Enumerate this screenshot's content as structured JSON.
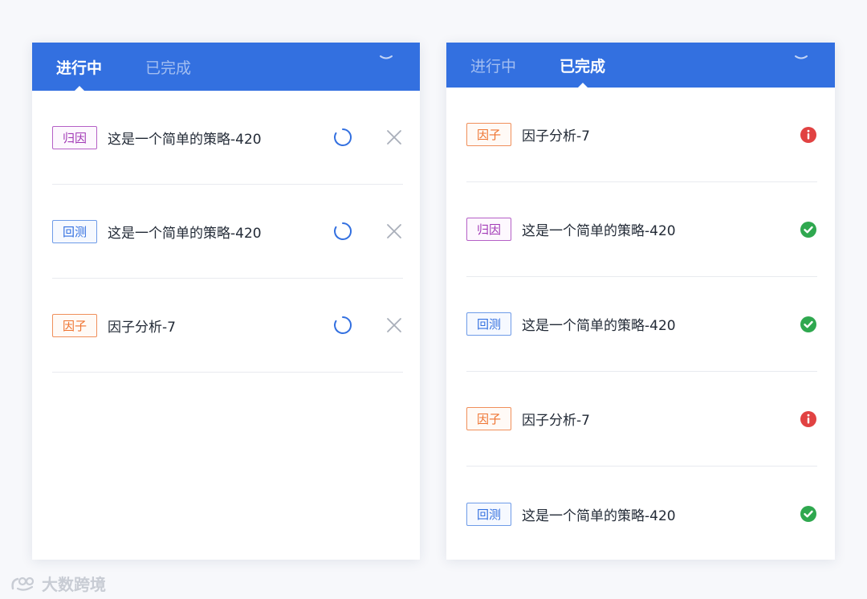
{
  "left_panel": {
    "tabs": [
      {
        "label": "进行中",
        "active": true
      },
      {
        "label": "已完成",
        "active": false
      }
    ],
    "items": [
      {
        "tag": "归因",
        "tag_color": "purple",
        "text": "这是一个简单的策略-420"
      },
      {
        "tag": "回测",
        "tag_color": "blue",
        "text": "这是一个简单的策略-420"
      },
      {
        "tag": "因子",
        "tag_color": "orange",
        "text": "因子分析-7"
      }
    ]
  },
  "right_panel": {
    "tabs": [
      {
        "label": "进行中",
        "active": false
      },
      {
        "label": "已完成",
        "active": true
      }
    ],
    "items": [
      {
        "tag": "因子",
        "tag_color": "orange",
        "text": "因子分析-7",
        "status": "error"
      },
      {
        "tag": "归因",
        "tag_color": "purple",
        "text": "这是一个简单的策略-420",
        "status": "success"
      },
      {
        "tag": "回测",
        "tag_color": "blue",
        "text": "这是一个简单的策略-420",
        "status": "success"
      },
      {
        "tag": "因子",
        "tag_color": "orange",
        "text": "因子分析-7",
        "status": "error"
      },
      {
        "tag": "回测",
        "tag_color": "blue",
        "text": "这是一个简单的策略-420",
        "status": "success"
      }
    ]
  },
  "colors": {
    "header": "#3370e0",
    "purple": "#a23ab6",
    "blue": "#3370e0",
    "orange": "#ef7431",
    "success": "#2fa84f",
    "error": "#e14242"
  },
  "watermark": "大数跨境"
}
